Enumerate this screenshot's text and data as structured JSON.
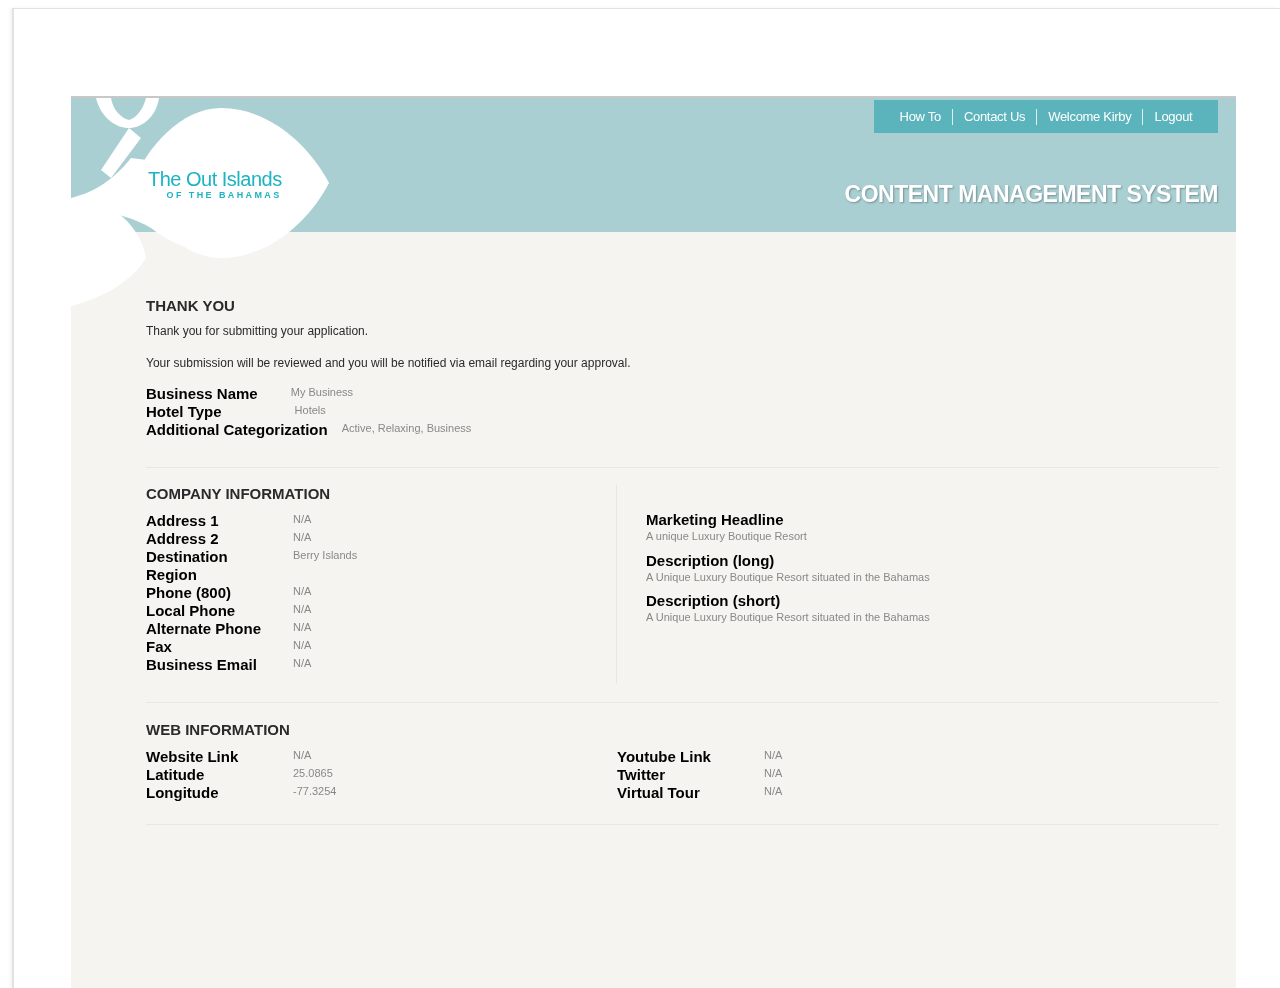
{
  "logo": {
    "title": "The Out Islands",
    "subtitle": "OF THE BAHAMAS"
  },
  "nav": [
    "How To",
    "Contact Us",
    "Welcome Kirby",
    "Logout"
  ],
  "header_title": "CONTENT MANAGEMENT SYSTEM",
  "thank_you": {
    "heading": "THANK YOU",
    "paragraphs": [
      "Thank you for submitting your application.",
      "Your submission will be reviewed and you will be notified via email regarding your approval."
    ],
    "fields": [
      {
        "label": "Business Name",
        "value": "My Business"
      },
      {
        "label": "Hotel Type",
        "value": "Hotels"
      },
      {
        "label": "Additional Categorization",
        "value": "Active, Relaxing, Business"
      }
    ]
  },
  "company_information": {
    "heading": "COMPANY INFORMATION",
    "fields": [
      {
        "label": "Address 1",
        "value": "N/A"
      },
      {
        "label": "Address 2",
        "value": "N/A"
      },
      {
        "label": "Destination",
        "value": "Berry Islands"
      },
      {
        "label": "Region"
      },
      {
        "label": "Phone (800)",
        "value": "N/A"
      },
      {
        "label": "Local Phone",
        "value": "N/A"
      },
      {
        "label": "Alternate Phone",
        "value": "N/A"
      },
      {
        "label": "Fax",
        "value": "N/A"
      },
      {
        "label": "Business Email",
        "value": "N/A"
      }
    ],
    "descriptions": [
      {
        "label": "Marketing Headline",
        "value": "A unique Luxury Boutique Resort"
      },
      {
        "label": "Description (long)",
        "value": "A Unique Luxury Boutique Resort situated in the Bahamas"
      },
      {
        "label": "Description (short)",
        "value": "A Unique Luxury Boutique Resort situated in the Bahamas"
      }
    ]
  },
  "web_information": {
    "heading": "WEB INFORMATION",
    "left_fields": [
      {
        "label": "Website Link",
        "value": "N/A"
      },
      {
        "label": "Latitude",
        "value": "25.0865"
      },
      {
        "label": "Longitude",
        "value": "-77.3254"
      }
    ],
    "right_fields": [
      {
        "label": "Youtube Link",
        "value": "N/A"
      },
      {
        "label": "Twitter",
        "value": "N/A"
      },
      {
        "label": "Virtual Tour",
        "value": "N/A"
      }
    ]
  }
}
